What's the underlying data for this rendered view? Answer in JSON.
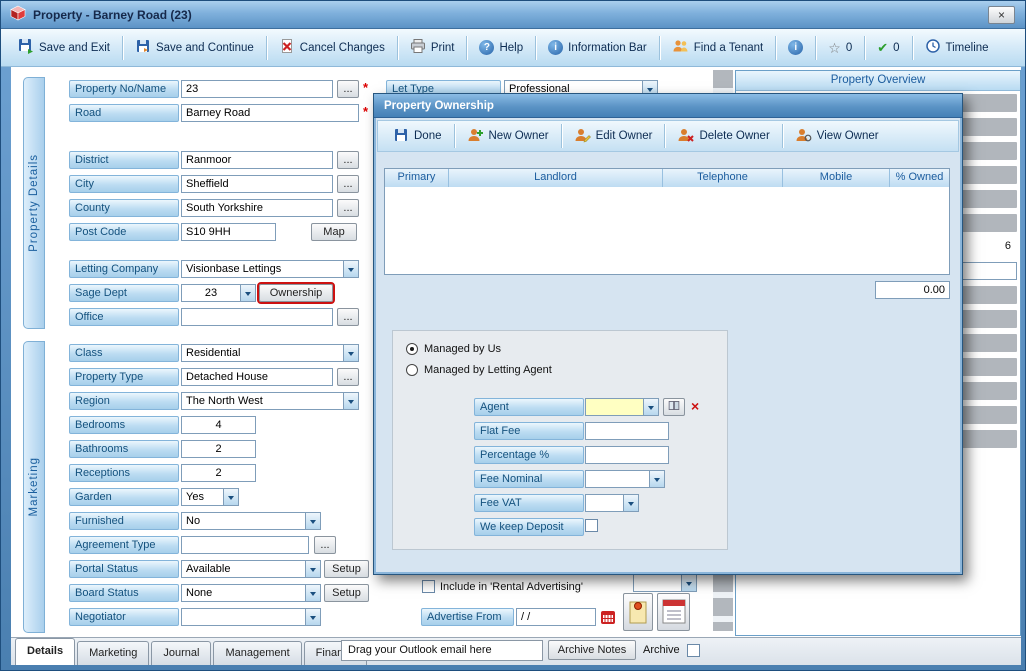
{
  "window": {
    "title": "Property  - Barney Road (23)",
    "close_glyph": "×"
  },
  "glyphs": {
    "question": "?",
    "info": "i",
    "star": "☆",
    "check": "✔",
    "cross": "×"
  },
  "toolbar": {
    "save_exit": "Save and Exit",
    "save_continue": "Save and Continue",
    "cancel": "Cancel Changes",
    "print": "Print",
    "help": "Help",
    "info_bar": "Information Bar",
    "find_tenant": "Find a Tenant",
    "star_count": "0",
    "check_count": "0",
    "timeline": "Timeline"
  },
  "side_tabs": {
    "details": "Property Details",
    "marketing": "Marketing"
  },
  "labels": {
    "ellipsis": "...",
    "required": "*",
    "map": "Map",
    "ownership": "Ownership",
    "setup": "Setup"
  },
  "form": {
    "property_no": {
      "label": "Property No/Name",
      "value": "23"
    },
    "road": {
      "label": "Road",
      "value": "Barney Road"
    },
    "district": {
      "label": "District",
      "value": "Ranmoor"
    },
    "city": {
      "label": "City",
      "value": "Sheffield"
    },
    "county": {
      "label": "County",
      "value": "South Yorkshire"
    },
    "post_code": {
      "label": "Post Code",
      "value": "S10 9HH"
    },
    "letting_company": {
      "label": "Letting Company",
      "value": "Visionbase Lettings"
    },
    "sage_dept": {
      "label": "Sage Dept",
      "value": "23"
    },
    "office": {
      "label": "Office",
      "value": ""
    },
    "class": {
      "label": "Class",
      "value": "Residential"
    },
    "property_type": {
      "label": "Property Type",
      "value": "Detached House"
    },
    "region": {
      "label": "Region",
      "value": "The North West"
    },
    "bedrooms": {
      "label": "Bedrooms",
      "value": "4"
    },
    "bathrooms": {
      "label": "Bathrooms",
      "value": "2"
    },
    "receptions": {
      "label": "Receptions",
      "value": "2"
    },
    "garden": {
      "label": "Garden",
      "value": "Yes"
    },
    "furnished": {
      "label": "Furnished",
      "value": "No"
    },
    "agreement_type": {
      "label": "Agreement Type",
      "value": ""
    },
    "portal_status": {
      "label": "Portal Status",
      "value": "Available"
    },
    "board_status": {
      "label": "Board Status",
      "value": "None"
    },
    "negotiator": {
      "label": "Negotiator",
      "value": ""
    },
    "let_type": {
      "label": "Let Type",
      "value": "Professional"
    }
  },
  "overview": {
    "title": "Property Overview",
    "visible_value": "6"
  },
  "advertising": {
    "include_label": "Include in 'Rental Advertising'",
    "advertise_from_label": "Advertise From",
    "advertise_from_value": "/ /"
  },
  "bottom": {
    "tabs": [
      "Details",
      "Marketing",
      "Journal",
      "Management",
      "Finance"
    ],
    "outlook_hint": "Drag your Outlook email here",
    "archive_notes": "Archive Notes",
    "archive": "Archive"
  },
  "dialog": {
    "title": "Property Ownership",
    "toolbar": {
      "done": "Done",
      "new_owner": "New Owner",
      "edit_owner": "Edit Owner",
      "delete_owner": "Delete Owner",
      "view_owner": "View Owner"
    },
    "grid_columns": [
      "Primary",
      "Landlord",
      "Telephone",
      "Mobile",
      "% Owned"
    ],
    "total": "0.00",
    "managed_by_us": "Managed by Us",
    "managed_by_agent": "Managed by Letting Agent",
    "fields": {
      "agent": {
        "label": "Agent",
        "value": ""
      },
      "flat_fee": {
        "label": "Flat Fee",
        "value": ""
      },
      "percentage": {
        "label": "Percentage %",
        "value": ""
      },
      "fee_nominal": {
        "label": "Fee Nominal",
        "value": ""
      },
      "fee_vat": {
        "label": "Fee VAT",
        "value": ""
      },
      "keep_deposit": {
        "label": "We keep Deposit"
      }
    }
  }
}
